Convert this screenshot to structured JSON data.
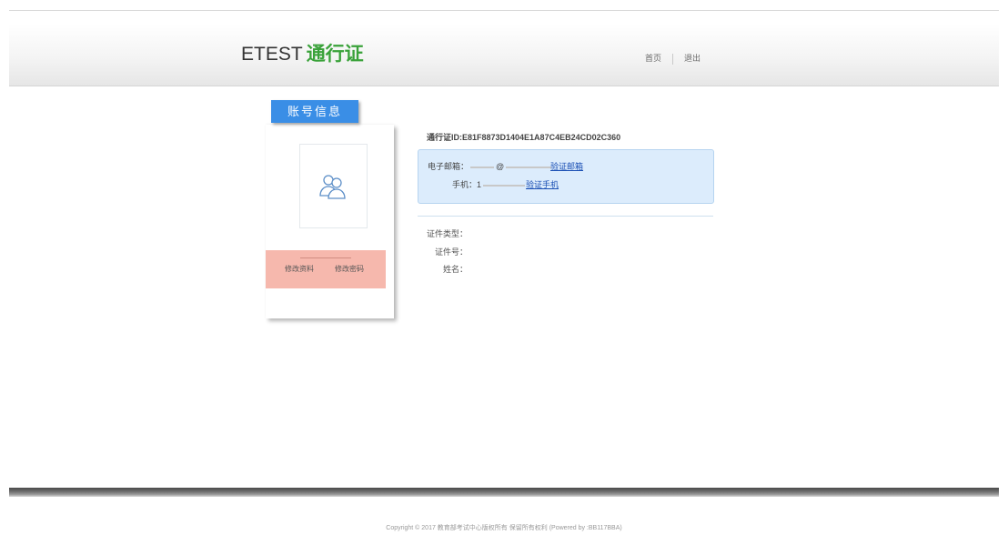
{
  "header": {
    "brand_en": "ETEST",
    "brand_cn": "通行证",
    "nav_home": "首页",
    "nav_logout": "退出"
  },
  "sidebar": {
    "tab_label": "账号信息",
    "edit_profile": "修改资料",
    "change_password": "修改密码"
  },
  "account": {
    "passport_id": "通行证ID:E81F8873D1404E1A87C4EB24CD02C360",
    "email_label": "电子邮箱：",
    "email_value_at": "@",
    "verify_email": "验证邮箱",
    "phone_label": "手机：",
    "phone_value_prefix": "1",
    "verify_phone": "验证手机",
    "id_type_label": "证件类型：",
    "id_number_label": "证件号：",
    "name_label": "姓名："
  },
  "footer": {
    "copyright": "Copyright © 2017 教育部考试中心版权所有 保留所有权利 (Powered by :BB117BBA)"
  },
  "colors": {
    "brand_green": "#3aa23a",
    "tab_blue": "#3a8ee6",
    "actions_pink": "#f6b8ad",
    "info_box_blue": "#dcecfc",
    "link_blue": "#1a4fb4"
  }
}
